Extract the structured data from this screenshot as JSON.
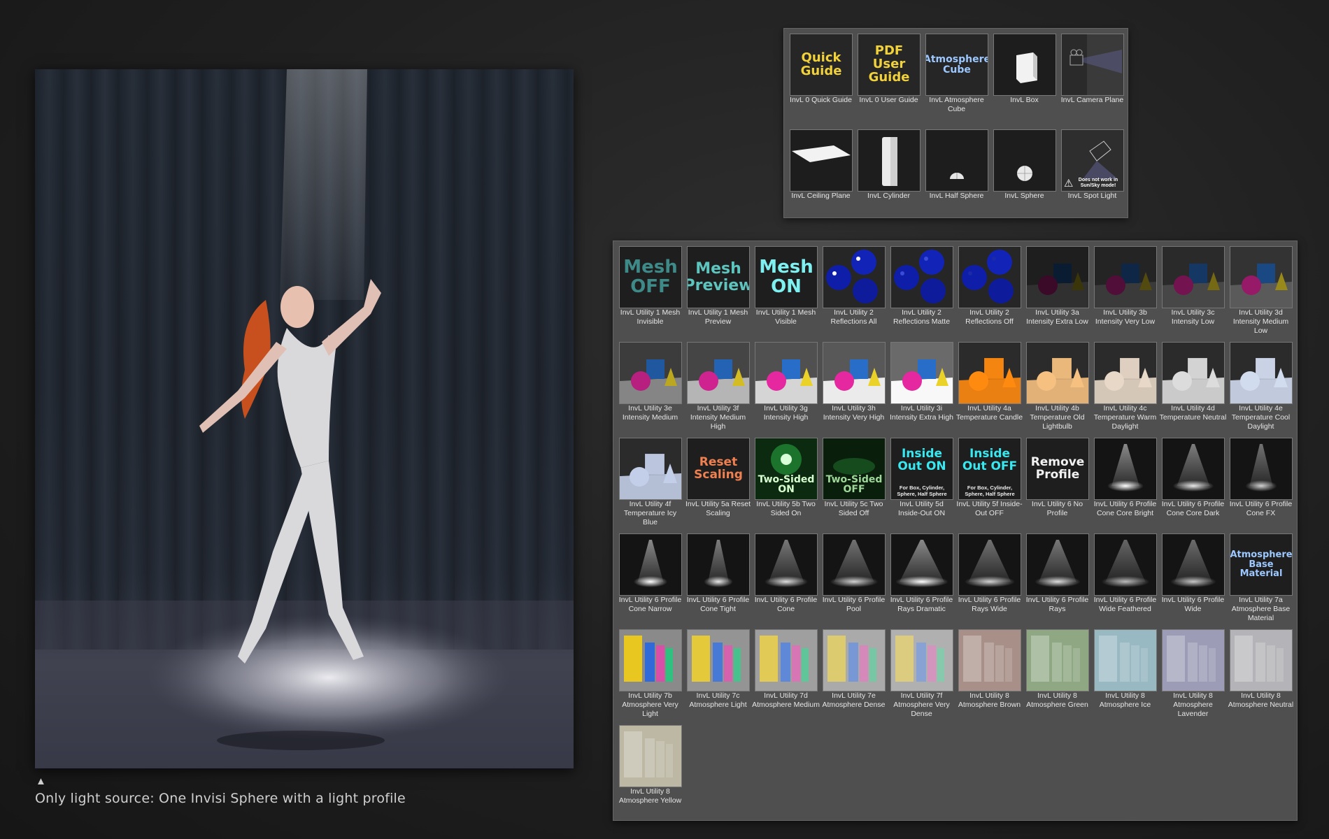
{
  "caption": {
    "arrow": "▲",
    "text": "Only light source: One Invisi Sphere with a light profile"
  },
  "render_image": {
    "subject": "dancer-spotlight-render-icon"
  },
  "top_panel": {
    "items": [
      {
        "label": "InvL 0 Quick Guide",
        "thumb_text": "Quick Guide",
        "style": "yellow",
        "icon": "quick-guide-icon"
      },
      {
        "label": "InvL 0 User Guide",
        "thumb_text": "PDF User Guide",
        "style": "yellow",
        "icon": "pdf-guide-icon"
      },
      {
        "label": "InvL Atmosphere Cube",
        "thumb_text": "Atmosphere Cube",
        "style": "blue",
        "icon": "atmosphere-cube-icon"
      },
      {
        "label": "InvL Box",
        "thumb_text": "",
        "style": "box",
        "icon": "box-icon"
      },
      {
        "label": "InvL Camera Plane",
        "thumb_text": "",
        "style": "camera",
        "icon": "camera-plane-icon"
      },
      {
        "label": "InvL Ceiling Plane",
        "thumb_text": "",
        "style": "plane",
        "icon": "ceiling-plane-icon"
      },
      {
        "label": "InvL Cylinder",
        "thumb_text": "",
        "style": "cylinder",
        "icon": "cylinder-icon"
      },
      {
        "label": "InvL Half Sphere",
        "thumb_text": "",
        "style": "halfsphere",
        "icon": "half-sphere-icon"
      },
      {
        "label": "InvL Sphere",
        "thumb_text": "",
        "style": "sphere",
        "icon": "sphere-icon"
      },
      {
        "label": "InvL Spot Light",
        "thumb_text": "",
        "style": "spot",
        "icon": "spot-light-icon",
        "note": "Does not work in Sun/Sky mode!"
      }
    ]
  },
  "main_panel": {
    "items": [
      {
        "label": "InvL Utility 1 Mesh Invisible",
        "thumb_text": "Mesh OFF",
        "style": "mesh-off"
      },
      {
        "label": "InvL Utility 1 Mesh Preview",
        "thumb_text": "Mesh Preview",
        "style": "mesh-preview"
      },
      {
        "label": "InvL Utility 1 Mesh Visible",
        "thumb_text": "Mesh ON",
        "style": "mesh-on"
      },
      {
        "label": "InvL Utility 2 Reflections All",
        "thumb_text": "",
        "style": "spheres-all"
      },
      {
        "label": "InvL Utility 2 Reflections Matte",
        "thumb_text": "",
        "style": "spheres-matte"
      },
      {
        "label": "InvL Utility 2 Reflections Off",
        "thumb_text": "",
        "style": "spheres-off"
      },
      {
        "label": "InvL Utility 3a Intensity Extra Low",
        "thumb_text": "",
        "style": "scene",
        "bg": "#1e1e1e",
        "ground": "#303030",
        "tint": 0.25
      },
      {
        "label": "InvL Utility 3b Intensity Very Low",
        "thumb_text": "",
        "style": "scene",
        "bg": "#242424",
        "ground": "#3a3a3a",
        "tint": 0.35
      },
      {
        "label": "InvL Utility 3c Intensity Low",
        "thumb_text": "",
        "style": "scene",
        "bg": "#2a2a2a",
        "ground": "#474747",
        "tint": 0.5
      },
      {
        "label": "InvL Utility 3d Intensity Medium Low",
        "thumb_text": "",
        "style": "scene",
        "bg": "#333",
        "ground": "#5a5a5a",
        "tint": 0.65
      },
      {
        "label": "InvL Utility 3e Intensity Medium",
        "thumb_text": "",
        "style": "scene",
        "bg": "#3c3c3c",
        "ground": "#858585",
        "tint": 0.8
      },
      {
        "label": "InvL Utility 3f Intensity Medium High",
        "thumb_text": "",
        "style": "scene",
        "bg": "#454545",
        "ground": "#b5b5b5",
        "tint": 0.9
      },
      {
        "label": "InvL Utility 3g Intensity High",
        "thumb_text": "",
        "style": "scene",
        "bg": "#505050",
        "ground": "#d5d5d5",
        "tint": 1.0
      },
      {
        "label": "InvL Utility 3h Intensity Very High",
        "thumb_text": "",
        "style": "scene",
        "bg": "#585858",
        "ground": "#ebebeb",
        "tint": 1.0
      },
      {
        "label": "InvL Utility 3i Intensity Extra High",
        "thumb_text": "",
        "style": "scene",
        "bg": "#6a6a6a",
        "ground": "#f8f8f8",
        "tint": 1.0
      },
      {
        "label": "InvL Utility 4a Temperature Candle",
        "thumb_text": "",
        "style": "temp",
        "color": "#ff8a10"
      },
      {
        "label": "InvL Utility 4b Temperature Old Lightbulb",
        "thumb_text": "",
        "style": "temp",
        "color": "#f5c080"
      },
      {
        "label": "InvL Utility 4c Temperature Warm Daylight",
        "thumb_text": "",
        "style": "temp",
        "color": "#e8d8c8"
      },
      {
        "label": "InvL Utility 4d Temperature Neutral",
        "thumb_text": "",
        "style": "temp",
        "color": "#dcdcdc"
      },
      {
        "label": "InvL Utility 4e Temperature Cool Daylight",
        "thumb_text": "",
        "style": "temp",
        "color": "#d2dcef"
      },
      {
        "label": "InvL Utility 4f Temperature Icy Blue",
        "thumb_text": "",
        "style": "temp",
        "color": "#c3cfe8"
      },
      {
        "label": "InvL Utility 5a Reset Scaling",
        "thumb_text": "Reset Scaling",
        "style": "reset"
      },
      {
        "label": "InvL Utility 5b Two Sided On",
        "thumb_text": "Two-Sided ON",
        "style": "twosided-on"
      },
      {
        "label": "InvL Utility 5c Two Sided Off",
        "thumb_text": "Two-Sided OFF",
        "style": "twosided-off"
      },
      {
        "label": "InvL Utility 5d Inside-Out ON",
        "thumb_text": "Inside Out ON",
        "style": "inside",
        "note": "For Box, Cylinder, Sphere, Half Sphere"
      },
      {
        "label": "InvL Utility 5f Inside-Out OFF",
        "thumb_text": "Inside Out OFF",
        "style": "inside",
        "note": "For Box, Cylinder, Sphere, Half Sphere"
      },
      {
        "label": "InvL Utility 6 No Profile",
        "thumb_text": "Remove Profile",
        "style": "remove"
      },
      {
        "label": "InvL Utility 6 Profile Cone Core Bright",
        "thumb_text": "",
        "style": "beam",
        "w": 0.35,
        "b": 1.0
      },
      {
        "label": "InvL Utility 6 Profile Cone Core Dark",
        "thumb_text": "",
        "style": "beam",
        "w": 0.45,
        "b": 0.9
      },
      {
        "label": "InvL Utility 6 Profile Cone FX",
        "thumb_text": "",
        "style": "beam",
        "w": 0.25,
        "b": 0.8
      },
      {
        "label": "InvL Utility 6 Profile Cone Narrow",
        "thumb_text": "",
        "style": "beam",
        "w": 0.3,
        "b": 1.0
      },
      {
        "label": "InvL Utility 6 Profile Cone Tight",
        "thumb_text": "",
        "style": "beam",
        "w": 0.2,
        "b": 0.9
      },
      {
        "label": "InvL Utility 6 Profile Cone",
        "thumb_text": "",
        "style": "beam",
        "w": 0.5,
        "b": 0.85
      },
      {
        "label": "InvL Utility 6 Profile Pool",
        "thumb_text": "",
        "style": "beam",
        "w": 0.6,
        "b": 0.8
      },
      {
        "label": "InvL Utility 6 Profile Rays Dramatic",
        "thumb_text": "",
        "style": "beam",
        "w": 0.7,
        "b": 1.0
      },
      {
        "label": "InvL Utility 6 Profile Rays Wide",
        "thumb_text": "",
        "style": "beam",
        "w": 0.65,
        "b": 0.8
      },
      {
        "label": "InvL Utility 6 Profile Rays",
        "thumb_text": "",
        "style": "beam",
        "w": 0.55,
        "b": 0.85
      },
      {
        "label": "InvL Utility 6 Profile Wide Feathered",
        "thumb_text": "",
        "style": "beam",
        "w": 0.6,
        "b": 0.7
      },
      {
        "label": "InvL Utility 6 Profile Wide",
        "thumb_text": "",
        "style": "beam",
        "w": 0.55,
        "b": 0.75
      },
      {
        "label": "InvL Utility 7a Atmosphere Base Material",
        "thumb_text": "Atmosphere Base Material",
        "style": "atm-base"
      },
      {
        "label": "InvL Utility 7b Atmosphere Very Light",
        "thumb_text": "",
        "style": "atm",
        "fog": 0.0
      },
      {
        "label": "InvL Utility 7c Atmosphere Light",
        "thumb_text": "",
        "style": "atm",
        "fog": 0.15
      },
      {
        "label": "InvL Utility 7d Atmosphere Medium",
        "thumb_text": "",
        "style": "atm",
        "fog": 0.3
      },
      {
        "label": "InvL Utility 7e Atmosphere Dense",
        "thumb_text": "",
        "style": "atm",
        "fog": 0.45
      },
      {
        "label": "InvL Utility 7f Atmosphere Very Dense",
        "thumb_text": "",
        "style": "atm",
        "fog": 0.55
      },
      {
        "label": "InvL Utility 8 Atmosphere Brown",
        "thumb_text": "",
        "style": "fog",
        "color": "#a89088"
      },
      {
        "label": "InvL Utility 8 Atmosphere Green",
        "thumb_text": "",
        "style": "fog",
        "color": "#8fa883"
      },
      {
        "label": "InvL Utility 8 Atmosphere Ice",
        "thumb_text": "",
        "style": "fog",
        "color": "#98b8c2"
      },
      {
        "label": "InvL Utility 8 Atmosphere Lavender",
        "thumb_text": "",
        "style": "fog",
        "color": "#9c9cb6"
      },
      {
        "label": "InvL Utility 8 Atmosphere Neutral",
        "thumb_text": "",
        "style": "fog",
        "color": "#b4b4b8"
      },
      {
        "label": "InvL Utility 8 Atmosphere Yellow",
        "thumb_text": "",
        "style": "fog",
        "color": "#bcb8a4"
      }
    ]
  }
}
